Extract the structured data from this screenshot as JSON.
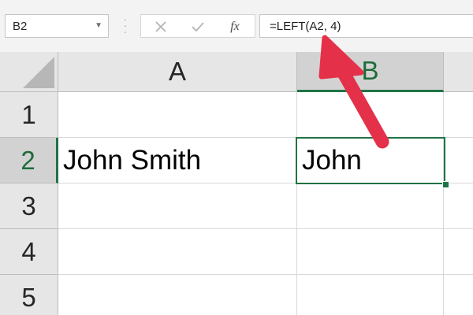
{
  "formula_bar": {
    "name_box": "B2",
    "name_box_dropdown_icon": "chevron-down-icon",
    "cancel_icon": "cross-icon",
    "enter_icon": "checkmark-icon",
    "function_icon": "fx-icon",
    "fx_label": "fx",
    "formula": "=LEFT(A2, 4)"
  },
  "grid": {
    "columns": [
      "A",
      "B",
      ""
    ],
    "selected_column": "B",
    "rows": [
      {
        "number": "1",
        "a": "",
        "b": "",
        "c": ""
      },
      {
        "number": "2",
        "a": "John Smith",
        "b": "John",
        "c": ""
      },
      {
        "number": "3",
        "a": "",
        "b": "",
        "c": ""
      },
      {
        "number": "4",
        "a": "",
        "b": "",
        "c": ""
      },
      {
        "number": "5",
        "a": "",
        "b": "",
        "c": ""
      }
    ],
    "selected_row": "2",
    "active_cell": "B2"
  },
  "annotation": {
    "arrow_color": "#e5304a",
    "arrow_icon": "red-arrow-pointer"
  },
  "colors": {
    "selection": "#217346",
    "header_background": "#e6e6e6",
    "selected_header_background": "#d2d2d2"
  }
}
